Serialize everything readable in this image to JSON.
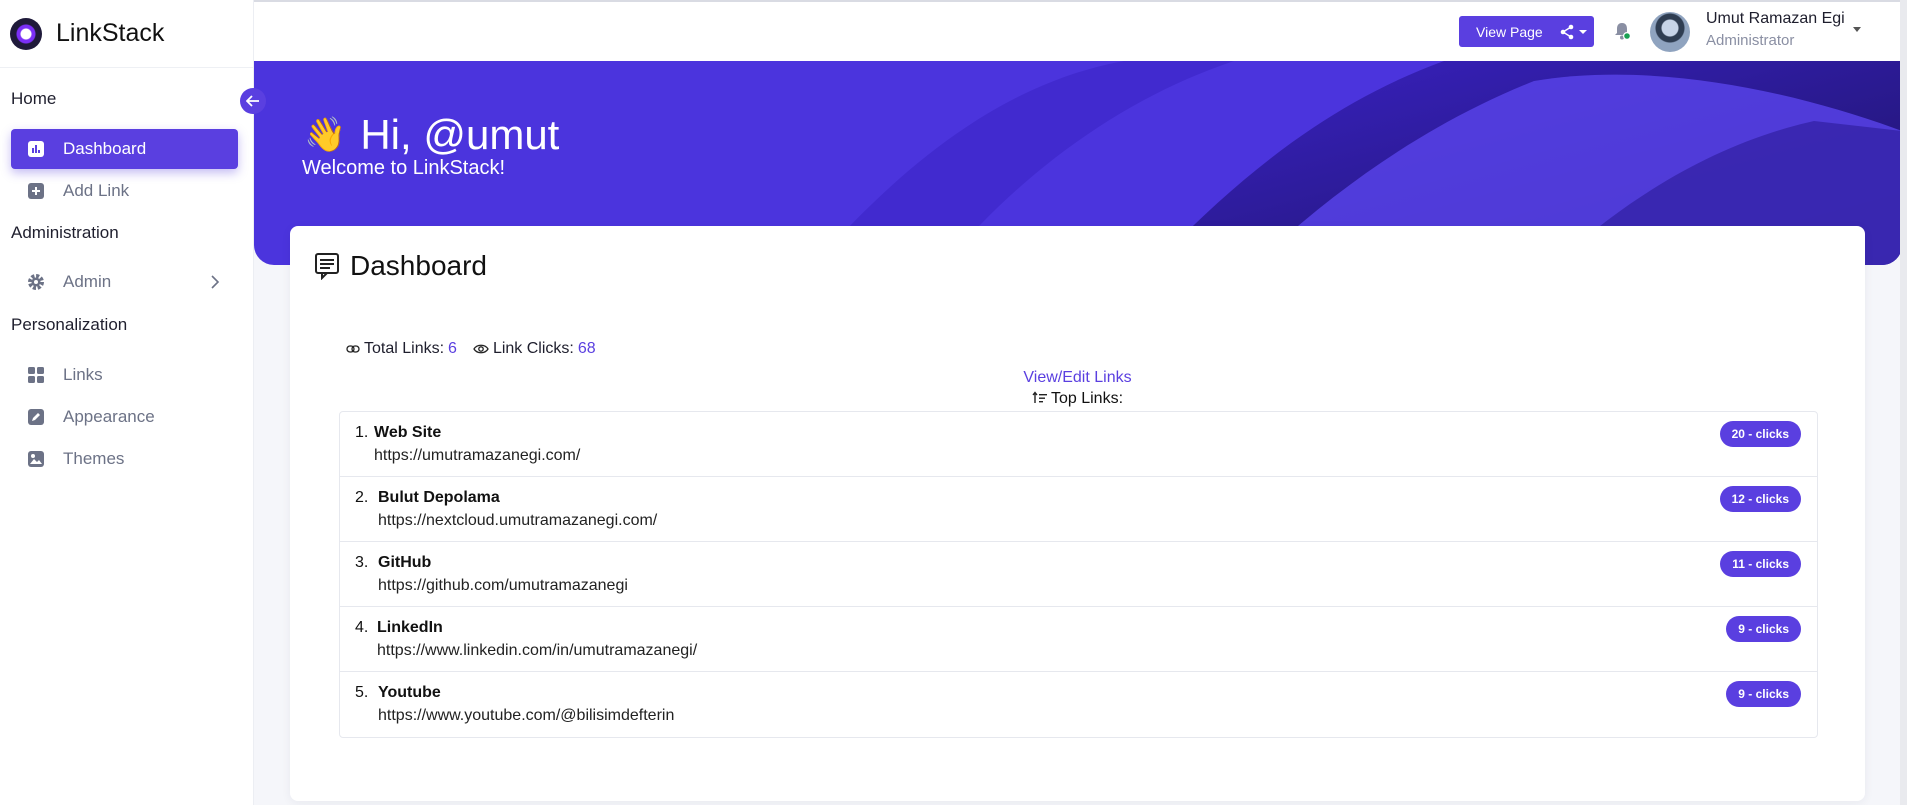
{
  "app": {
    "name": "LinkStack"
  },
  "sidebar": {
    "sections": {
      "home": "Home",
      "administration": "Administration",
      "personalization": "Personalization"
    },
    "items": [
      {
        "label": "Dashboard",
        "icon": "dashboard-icon",
        "active": true
      },
      {
        "label": "Add Link",
        "icon": "plus-square-icon"
      },
      {
        "label": "Admin",
        "icon": "gear-icon"
      },
      {
        "label": "Links",
        "icon": "grid-icon"
      },
      {
        "label": "Appearance",
        "icon": "edit-icon"
      },
      {
        "label": "Themes",
        "icon": "image-icon"
      }
    ]
  },
  "topbar": {
    "view_page": "View Page",
    "user_name": "Umut Ramazan Egi",
    "user_role": "Administrator"
  },
  "hero": {
    "greeting": "Hi, @umut",
    "subtitle": "Welcome to LinkStack!"
  },
  "dashboard": {
    "title": "Dashboard",
    "total_links_label": "Total Links:",
    "total_links": "6",
    "link_clicks_label": "Link Clicks:",
    "link_clicks": "68",
    "view_edit": "View/Edit Links",
    "top_links": "Top Links:",
    "links": [
      {
        "index": "1.",
        "title": "Web Site",
        "url": "https://umutramazanegi.com/",
        "clicks": "20 - clicks"
      },
      {
        "index": "2.",
        "title": "Bulut Depolama",
        "url": "https://nextcloud.umutramazanegi.com/",
        "clicks": "12 - clicks"
      },
      {
        "index": "3.",
        "title": "GitHub",
        "url": "https://github.com/umutramazanegi",
        "clicks": "11 - clicks"
      },
      {
        "index": "4.",
        "title": "LinkedIn",
        "url": "https://www.linkedin.com/in/umutramazanegi/",
        "clicks": "9 - clicks"
      },
      {
        "index": "5.",
        "title": "Youtube",
        "url": "https://www.youtube.com/@bilisimdefterin",
        "clicks": "9 - clicks"
      }
    ]
  },
  "colors": {
    "accent": "#5a3fe0",
    "hero": "#4b34dd"
  }
}
